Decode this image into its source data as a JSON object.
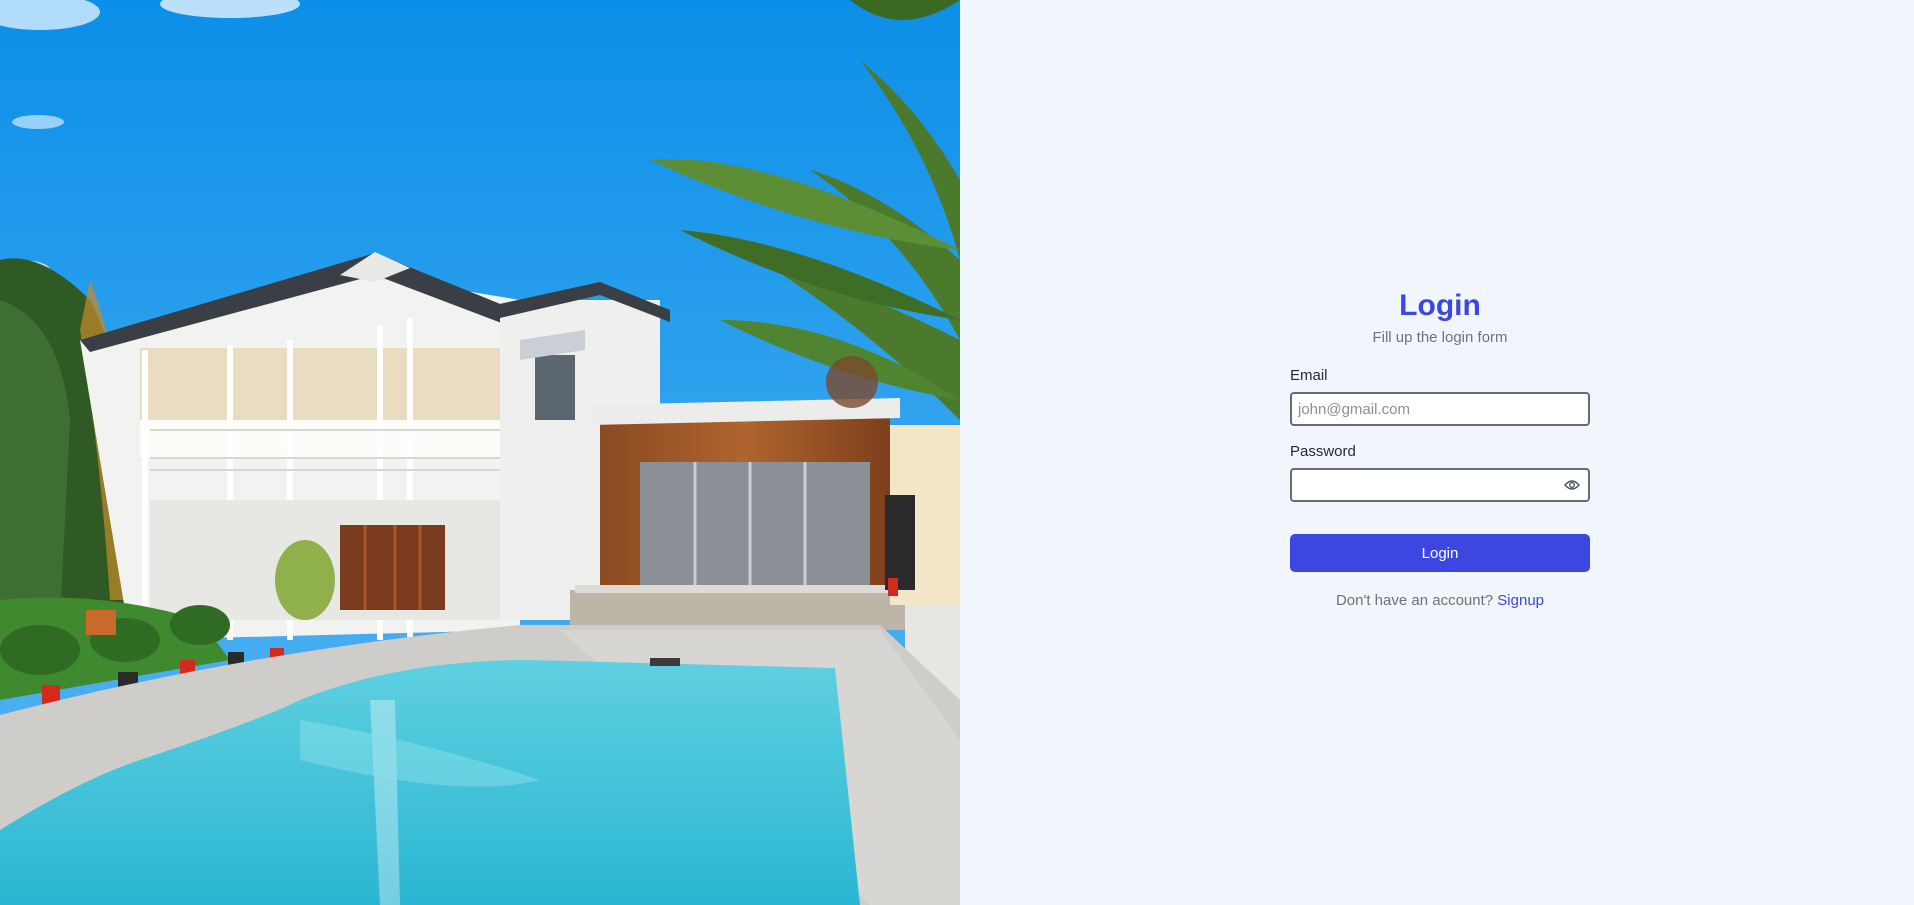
{
  "hero": {
    "image_name": "house-with-pool-photo"
  },
  "login": {
    "title": "Login",
    "subtitle": "Fill up the login form",
    "email_label": "Email",
    "email_placeholder": "john@gmail.com",
    "email_value": "",
    "password_label": "Password",
    "password_value": "",
    "password_toggle_icon": "eye-icon",
    "submit_label": "Login",
    "signup_prompt": "Don't have an account?",
    "signup_link": "Signup"
  },
  "colors": {
    "accent": "#3b47e0",
    "panel_background": "#f1f6fd",
    "muted_text": "#6b7280"
  }
}
